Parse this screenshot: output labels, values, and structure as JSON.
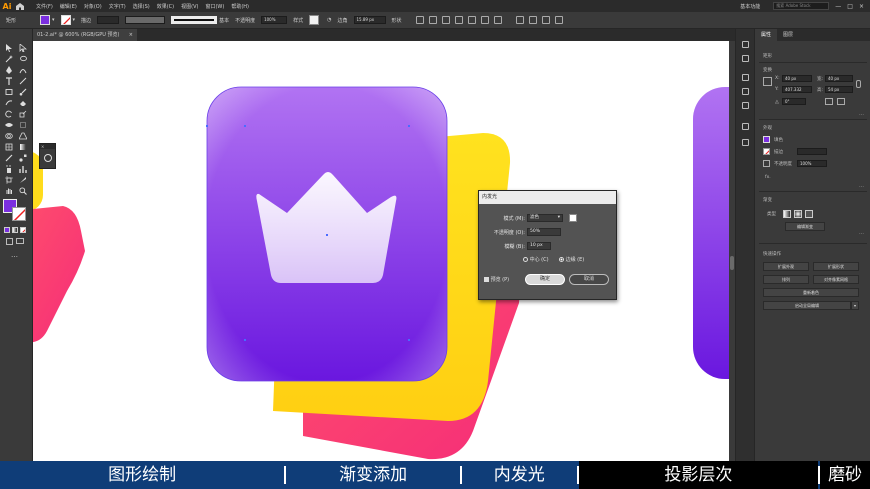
{
  "menubar": {
    "logo": "Ai",
    "items": [
      "文件(F)",
      "编辑(E)",
      "对象(O)",
      "文字(T)",
      "选择(S)",
      "效果(C)",
      "视图(V)",
      "窗口(W)",
      "帮助(H)"
    ],
    "workspace": "基本功能",
    "search_placeholder": "搜索 Adobe Stock"
  },
  "controlbar": {
    "object_type": "矩形",
    "fill_color": "#7b2fe0",
    "stroke_label": "描边",
    "brush_label": "基本",
    "opacity_label": "不透明度",
    "opacity_value": "100%",
    "style_label": "样式",
    "corner_label": "边角",
    "corner_value": "15.89 px",
    "shape_label": "形状"
  },
  "document": {
    "tab_title": "01-2.ai* @ 600% (RGB/GPU 预览)",
    "close": "×"
  },
  "properties": {
    "tabs": [
      "属性",
      "图层"
    ],
    "section_shape": "矩形",
    "section_transform": "变换",
    "x_label": "X:",
    "x_value": "40 px",
    "y_label": "Y:",
    "y_value": "407.332",
    "w_label": "宽:",
    "w_value": "40 px",
    "h_label": "高:",
    "h_value": "54 px",
    "angle_value": "0°",
    "section_appearance": "外观",
    "fill_label": "填色",
    "stroke_label": "描边",
    "opacity_label": "不透明度",
    "opacity_value": "100%",
    "fx_label": "fx.",
    "section_gradient": "渐变",
    "gradient_type_label": "类型",
    "edit_gradient_button": "编辑渐变",
    "section_quick_actions": "快速操作",
    "btn_expand_appearance": "扩展外观",
    "btn_expand": "扩展形状",
    "btn_arrange": "排列",
    "btn_align": "对齐像素网格",
    "btn_recolor": "重新着色",
    "btn_global_edit": "启动全局编辑"
  },
  "dialog": {
    "title": "内发光",
    "mode_label": "模式 (M):",
    "mode_value": "滤色",
    "opacity_label": "不透明度 (O):",
    "opacity_value": "50%",
    "blur_label": "模糊 (B):",
    "blur_value": "10 px",
    "center_label": "中心 (C)",
    "edge_label": "边缘 (E)",
    "preview_label": "预览 (P)",
    "ok_button": "确定",
    "cancel_button": "取消"
  },
  "captions": {
    "steps": [
      "图形绘制",
      "渐变添加",
      "内发光",
      "投影层次",
      "磨砂"
    ],
    "active_index": 2
  },
  "colors": {
    "purple_top": "#b173f2",
    "purple_bottom": "#6a17df",
    "yellow": "#ffdf1b",
    "pink": "#f9306f",
    "accent_orange": "#ff9a00"
  }
}
